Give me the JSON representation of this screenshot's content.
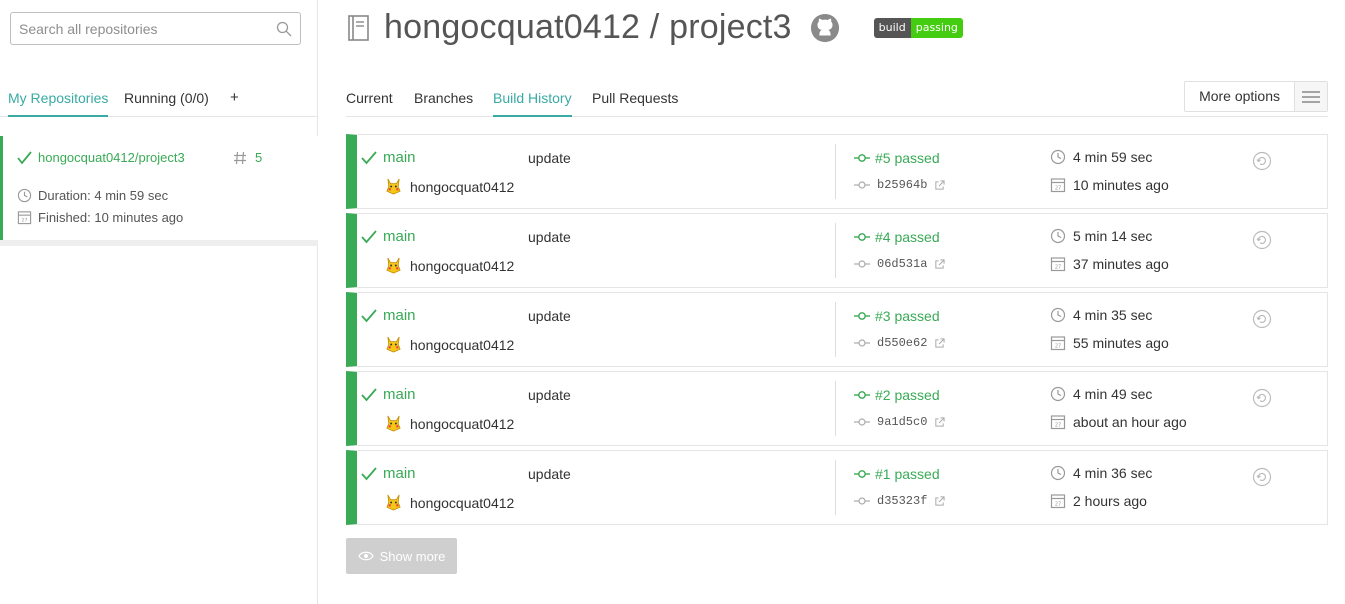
{
  "sidebar": {
    "search_placeholder": "Search all repositories",
    "tabs": [
      {
        "label": "My Repositories"
      },
      {
        "label": "Running (0/0)"
      }
    ],
    "add_label": "+",
    "repo": {
      "name": "hongocquat0412/project3",
      "build_number": "5",
      "duration": "Duration: 4 min 59 sec",
      "finished": "Finished: 10 minutes ago"
    }
  },
  "header": {
    "title": "hongocquat0412 / project3",
    "badge_left": "build",
    "badge_right": "passing"
  },
  "tabs": [
    {
      "label": "Current"
    },
    {
      "label": "Branches"
    },
    {
      "label": "Build History"
    },
    {
      "label": "Pull Requests"
    }
  ],
  "more_options": "More options",
  "builds": [
    {
      "branch": "main",
      "message": "update",
      "author": "hongocquat0412",
      "state": "#5 passed",
      "commit": "b25964b",
      "duration": "4 min 59 sec",
      "finished": "10 minutes ago"
    },
    {
      "branch": "main",
      "message": "update",
      "author": "hongocquat0412",
      "state": "#4 passed",
      "commit": "06d531a",
      "duration": "5 min 14 sec",
      "finished": "37 minutes ago"
    },
    {
      "branch": "main",
      "message": "update",
      "author": "hongocquat0412",
      "state": "#3 passed",
      "commit": "d550e62",
      "duration": "4 min 35 sec",
      "finished": "55 minutes ago"
    },
    {
      "branch": "main",
      "message": "update",
      "author": "hongocquat0412",
      "state": "#2 passed",
      "commit": "9a1d5c0",
      "duration": "4 min 49 sec",
      "finished": "about an hour ago"
    },
    {
      "branch": "main",
      "message": "update",
      "author": "hongocquat0412",
      "state": "#1 passed",
      "commit": "d35323f",
      "duration": "4 min 36 sec",
      "finished": "2 hours ago"
    }
  ],
  "show_more": "Show more",
  "colors": {
    "passed": "#39aa56",
    "accent": "#39aaa4"
  }
}
